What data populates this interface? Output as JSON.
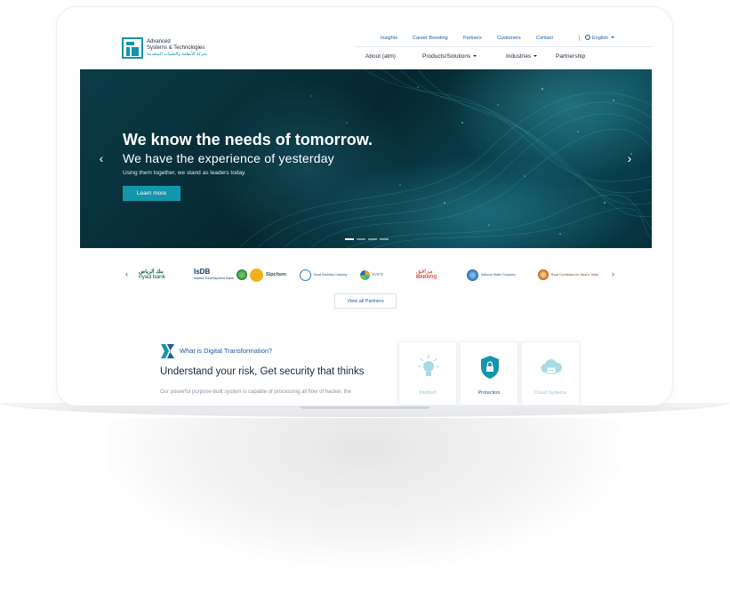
{
  "brand": {
    "name_line1": "Advanced",
    "name_line2": "Systems & Technologies",
    "name_arabic": "شركة الأنظمة والتقنيات المتقدمة",
    "color": "#1493a8"
  },
  "top_nav": [
    "Insights",
    "Career Boosting",
    "Partners",
    "Customers",
    "Contact"
  ],
  "language": "English",
  "main_nav": [
    "About (atm)",
    "Products/Solutions",
    "Industries",
    "Partnership"
  ],
  "hero": {
    "title": "We know the needs of tomorrow.",
    "subtitle": "We have the experience of yesterday",
    "description": "Using them together, we stand  as leaders today.",
    "button": "Learn more",
    "slides": 4,
    "active_slide": 1
  },
  "partners": {
    "items": [
      {
        "name": "riyad bank",
        "arabic": "بنك الرياض"
      },
      {
        "name": "IsDB",
        "sub": "Islamic Development Bank"
      },
      {
        "name": "Sipchem"
      },
      {
        "name": "Saudi Electricity Company"
      },
      {
        "name": "KAFD"
      },
      {
        "name": "MARAFIQ",
        "arabic": "مرافق"
      },
      {
        "name": "National Water Company"
      },
      {
        "name": "Royal Commission for Jubail & Yanbu"
      }
    ],
    "view_all": "View all Partners"
  },
  "digital": {
    "heading": "What is Digital Transformation?",
    "title": "Understand your risk, Get security that thinks",
    "body": "Our powerful purpose-built system is capable of processing all flow of hacker, the",
    "cards": [
      "Intellect",
      "Protection",
      "Cloud Systems"
    ]
  },
  "colors": {
    "accent": "#1496aa",
    "link": "#1a5aa8",
    "hero_bg": "#062730"
  }
}
